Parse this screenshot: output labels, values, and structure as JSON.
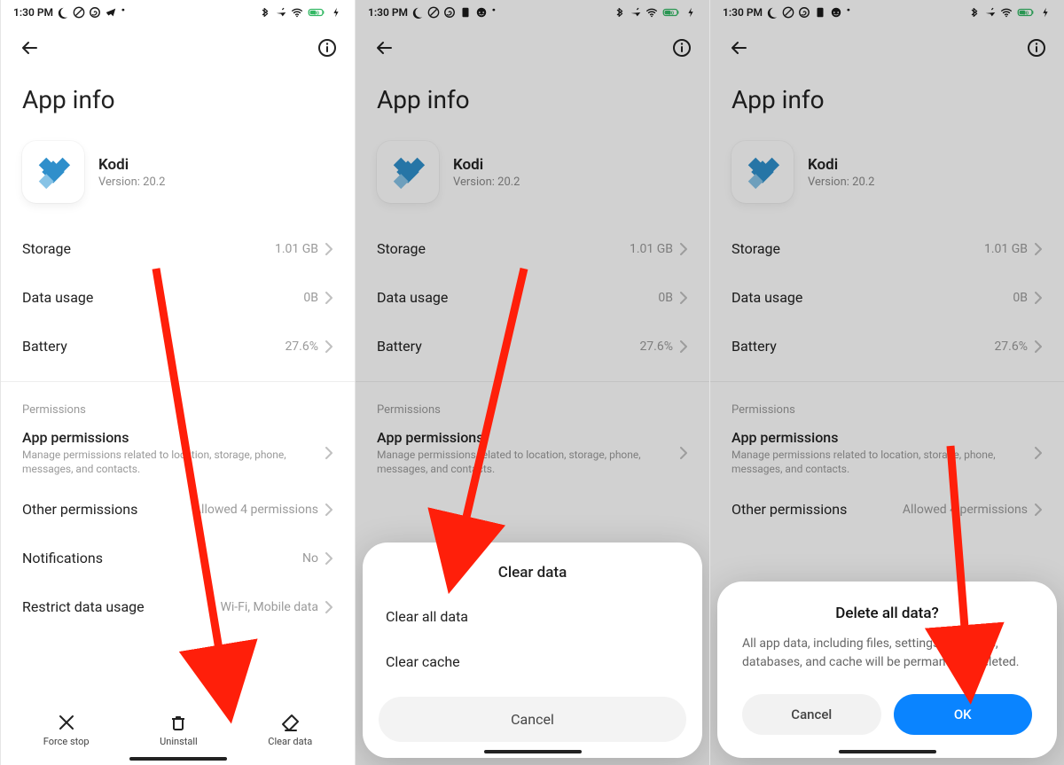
{
  "status": {
    "time": "1:30 PM",
    "battery_pct": "50"
  },
  "page": {
    "title": "App info"
  },
  "app": {
    "name": "Kodi",
    "version_label": "Version: 20.2"
  },
  "rows": {
    "storage": {
      "label": "Storage",
      "value": "1.01 GB"
    },
    "data_usage": {
      "label": "Data usage",
      "value": "0B"
    },
    "battery": {
      "label": "Battery",
      "value": "27.6%"
    }
  },
  "permissions": {
    "section": "Permissions",
    "app_perm": {
      "title": "App permissions",
      "desc": "Manage permissions related to location, storage, phone, messages, and contacts."
    },
    "other": {
      "label": "Other permissions",
      "value": "Allowed 4 permissions"
    },
    "notifications": {
      "label": "Notifications",
      "value": "No"
    },
    "restrict": {
      "label": "Restrict data usage",
      "value": "Wi-Fi, Mobile data"
    }
  },
  "bottom": {
    "force_stop": "Force stop",
    "uninstall": "Uninstall",
    "clear_data": "Clear data"
  },
  "sheet": {
    "title": "Clear data",
    "clear_all": "Clear all data",
    "clear_cache": "Clear cache",
    "cancel": "Cancel"
  },
  "dialog": {
    "title": "Delete all data?",
    "body": "All app data, including files, settings, accounts, databases, and cache will be permanently deleted.",
    "cancel": "Cancel",
    "ok": "OK"
  },
  "colors": {
    "accent": "#0a84ff",
    "annotation": "#ff1f0a"
  }
}
